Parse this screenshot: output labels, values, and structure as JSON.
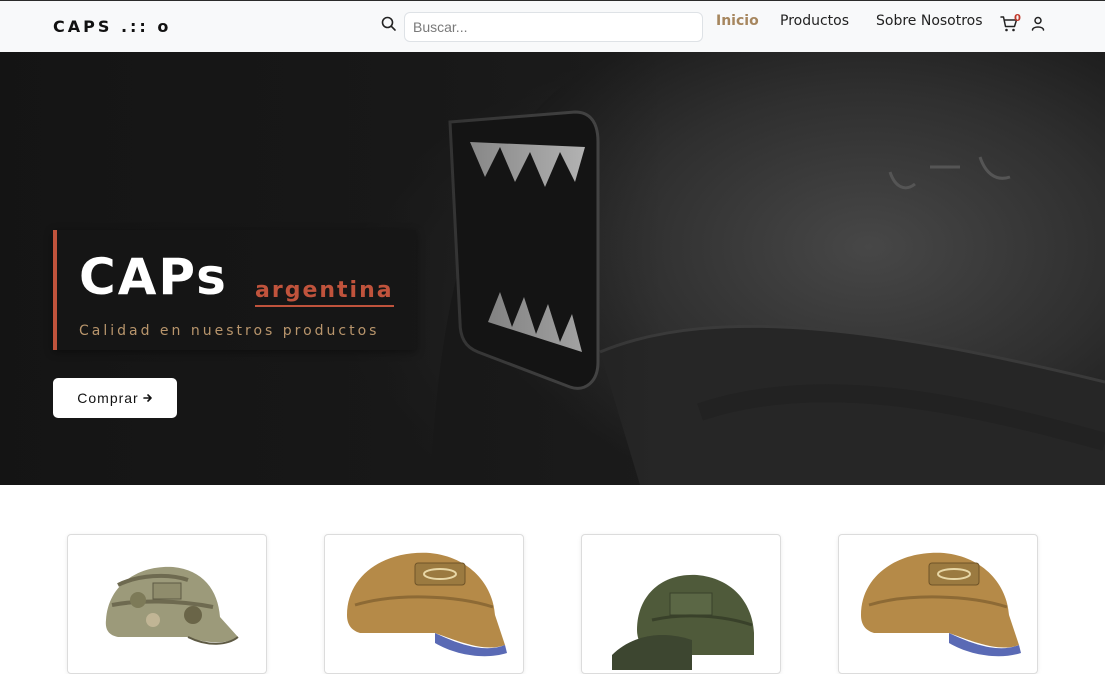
{
  "nav": {
    "brand": "CAPS .:: o",
    "search_placeholder": "Buscar...",
    "links": [
      {
        "label": "Inicio",
        "active": true
      },
      {
        "label": "Productos",
        "active": false
      },
      {
        "label": "Sobre Nosotros",
        "active": false
      }
    ],
    "cart_count": "0",
    "icons": [
      "search-icon",
      "cart-icon",
      "user-icon"
    ]
  },
  "hero": {
    "title": "CAPs",
    "subtitle": "argentina",
    "tagline": "Calidad en nuestros productos",
    "cta_label": "Comprar",
    "cta_icon": "arrow-right-icon"
  },
  "colors": {
    "accent": "#c0533c",
    "gold": "#b8956c",
    "active_link": "#a6865e",
    "nav_bg": "#f8f9fa"
  },
  "products": [
    {
      "image": "camo-cap"
    },
    {
      "image": "tan-cap"
    },
    {
      "image": "olive-cap"
    },
    {
      "image": "tan-cap"
    }
  ]
}
